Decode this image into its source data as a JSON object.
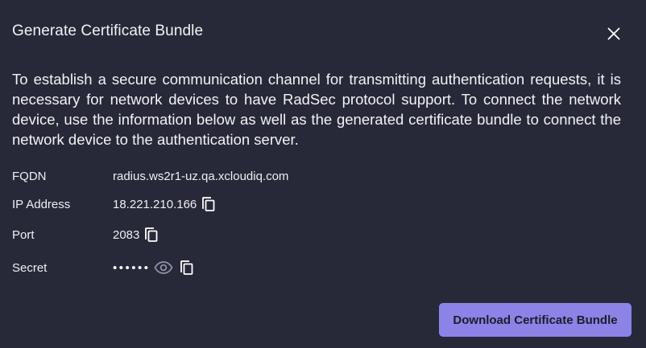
{
  "dialog": {
    "title": "Generate Certificate Bundle",
    "description": "To establish a secure communication channel for transmitting authentication requests, it is necessary for network devices to have RadSec protocol support. To connect the network device, use the information below as well as the generated certificate bundle to connect the network device to the authentication server.",
    "fields": {
      "fqdn": {
        "label": "FQDN",
        "value": "radius.ws2r1-uz.qa.xcloudiq.com"
      },
      "ip": {
        "label": "IP Address",
        "value": "18.221.210.166"
      },
      "port": {
        "label": "Port",
        "value": "2083"
      },
      "secret": {
        "label": "Secret",
        "masked_value": "••••••"
      }
    },
    "download_label": "Download Certificate Bundle"
  },
  "icons": {
    "close": "close-icon",
    "copy": "copy-icon",
    "show_password": "eye-icon"
  },
  "colors": {
    "background": "#272838",
    "primary_button": "#8b83e6",
    "text": "#f2f2f5",
    "eye_icon": "#8e91a8"
  }
}
